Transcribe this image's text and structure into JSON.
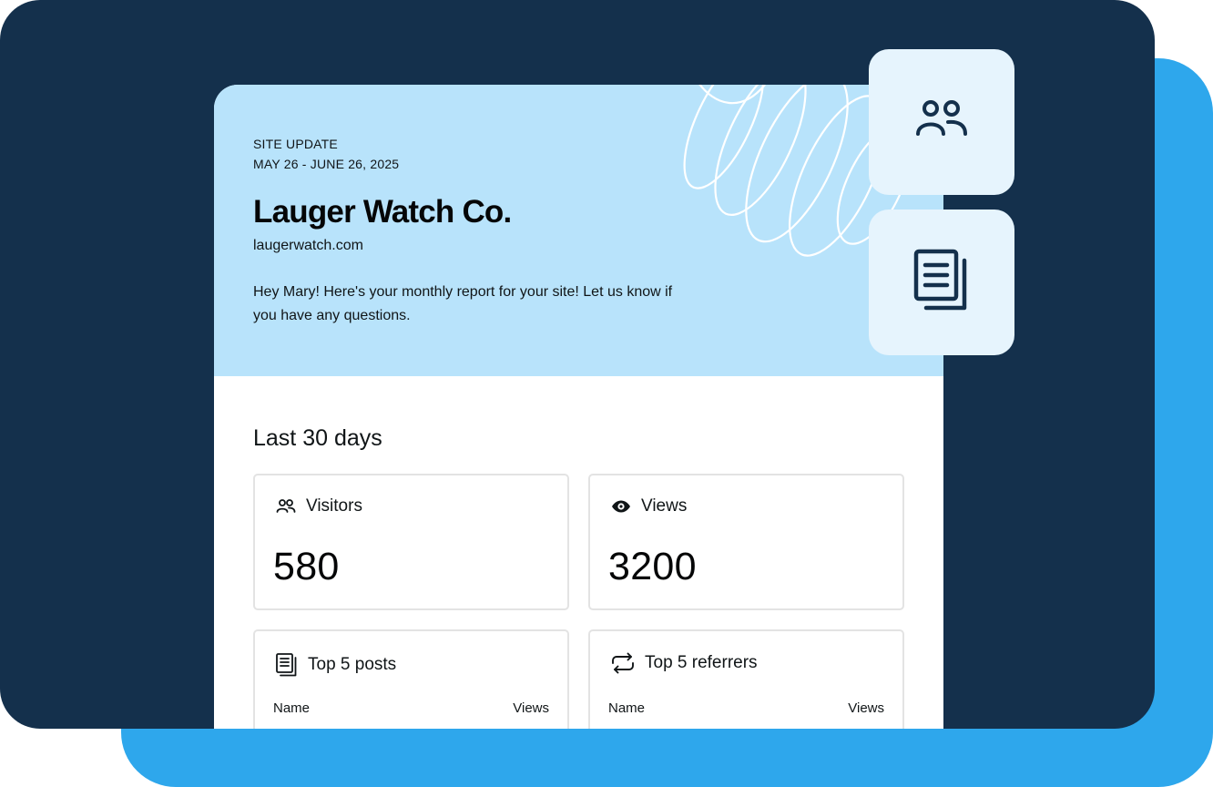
{
  "report": {
    "eyebrow": "SITE UPDATE",
    "date_range": "MAY 26 - JUNE 26, 2025",
    "site_name": "Lauger Watch Co.",
    "site_url": "laugerwatch.com",
    "greeting": "Hey Mary! Here's your monthly report for your site! Let us know if you have any questions."
  },
  "stats": {
    "section_title": "Last 30 days",
    "visitors": {
      "label": "Visitors",
      "value": "580",
      "icon": "people-icon"
    },
    "views": {
      "label": "Views",
      "value": "3200",
      "icon": "eye-icon"
    }
  },
  "top_posts": {
    "title": "Top 5 posts",
    "col_name": "Name",
    "col_views": "Views",
    "icon": "posts-icon"
  },
  "top_referrers": {
    "title": "Top 5 referrers",
    "col_name": "Name",
    "col_views": "Views",
    "icon": "repeat-icon"
  },
  "side_tiles": [
    {
      "icon": "people-icon"
    },
    {
      "icon": "posts-icon"
    }
  ],
  "colors": {
    "navy": "#14304c",
    "blue": "#2ea7ec",
    "header_blue": "#b8e3fb",
    "tile_blue": "#e6f4fd"
  }
}
